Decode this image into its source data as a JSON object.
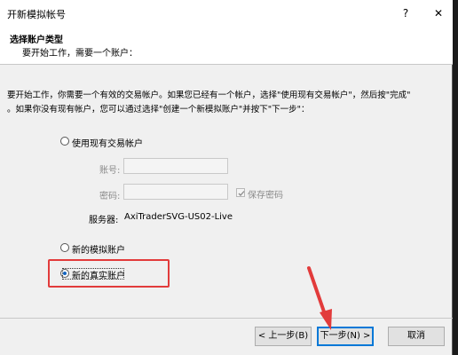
{
  "window": {
    "title": "开新模拟帐号",
    "help_label": "?",
    "close_label": "✕"
  },
  "header": {
    "title": "选择账户类型",
    "subtitle": "要开始工作，需要一个账户："
  },
  "description": {
    "line1": "要开始工作，你需要一个有效的交易帐户。如果您已经有一个帐户，选择\"使用现有交易帐户\"，然后按\"完成\"",
    "line2": "。如果你没有现有帐户，您可以通过选择\"创建一个新模拟账户\"并按下\"下一步\"："
  },
  "options": {
    "existing_label": "使用现有交易帐户",
    "demo_label": "新的模拟账户",
    "real_label": "新的真实账户",
    "selected": "real"
  },
  "form": {
    "account_label": "账号:",
    "account_value": "",
    "password_label": "密码:",
    "password_value": "",
    "save_password_label": "保存密码",
    "save_password_checked": true,
    "server_label": "服务器:",
    "server_value": "AxiTraderSVG-US02-Live"
  },
  "buttons": {
    "back_label": "< 上一步(B)",
    "next_label": "下一步(N) >",
    "cancel_label": "取消"
  },
  "annotations": {
    "highlight_color": "#e23b3b",
    "arrow_color": "#e23b3b"
  }
}
